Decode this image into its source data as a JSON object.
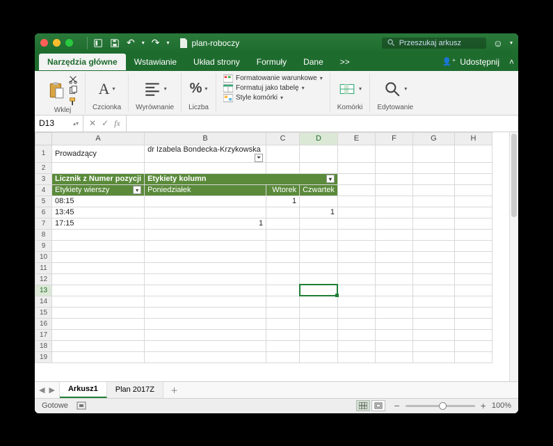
{
  "titlebar": {
    "filename": "plan-roboczy",
    "search_placeholder": "Przeszukaj arkusz"
  },
  "tabs": {
    "home": "Narzędzia główne",
    "insert": "Wstawianie",
    "layout": "Układ strony",
    "formulas": "Formuły",
    "data": "Dane",
    "more": ">>",
    "share": "Udostępnij"
  },
  "ribbon": {
    "paste": "Wklej",
    "font": "Czcionka",
    "align": "Wyrównanie",
    "number": "Liczba",
    "cond_fmt": "Formatowanie warunkowe",
    "fmt_table": "Formatuj jako tabelę",
    "cell_styles": "Style komórki",
    "cells": "Komórki",
    "editing": "Edytowanie"
  },
  "namebox": "D13",
  "columns": [
    "A",
    "B",
    "C",
    "D",
    "E",
    "F",
    "G",
    "H"
  ],
  "sel": {
    "col": "D",
    "row": 13
  },
  "cells": {
    "r1": {
      "A": "Prowadzący",
      "B": "dr Izabela Bondecka-Krzykowska"
    },
    "r3": {
      "A": "Licznik z Numer pozycji",
      "B": "Etykiety kolumn"
    },
    "r4": {
      "A": "Etykiety wierszy",
      "B": "Poniedziałek",
      "C": "Wtorek",
      "D": "Czwartek"
    },
    "r5": {
      "A": "08:15",
      "C": "1"
    },
    "r6": {
      "A": "13:45",
      "D": "1"
    },
    "r7": {
      "A": "17:15",
      "B": "1"
    }
  },
  "sheets": {
    "s1": "Arkusz1",
    "s2": "Plan 2017Z"
  },
  "status": {
    "ready": "Gotowe",
    "zoom": "100%"
  },
  "chart_data": {
    "type": "table",
    "title": "Licznik z Numer pozycji",
    "filter": {
      "field": "Prowadzący",
      "value": "dr Izabela Bondecka-Krzykowska"
    },
    "row_field": "Etykiety wierszy",
    "col_field": "Etykiety kolumn",
    "columns": [
      "Poniedziałek",
      "Wtorek",
      "Czwartek"
    ],
    "rows": [
      {
        "label": "08:15",
        "values": [
          null,
          1,
          null
        ]
      },
      {
        "label": "13:45",
        "values": [
          null,
          null,
          1
        ]
      },
      {
        "label": "17:15",
        "values": [
          1,
          null,
          null
        ]
      }
    ]
  }
}
